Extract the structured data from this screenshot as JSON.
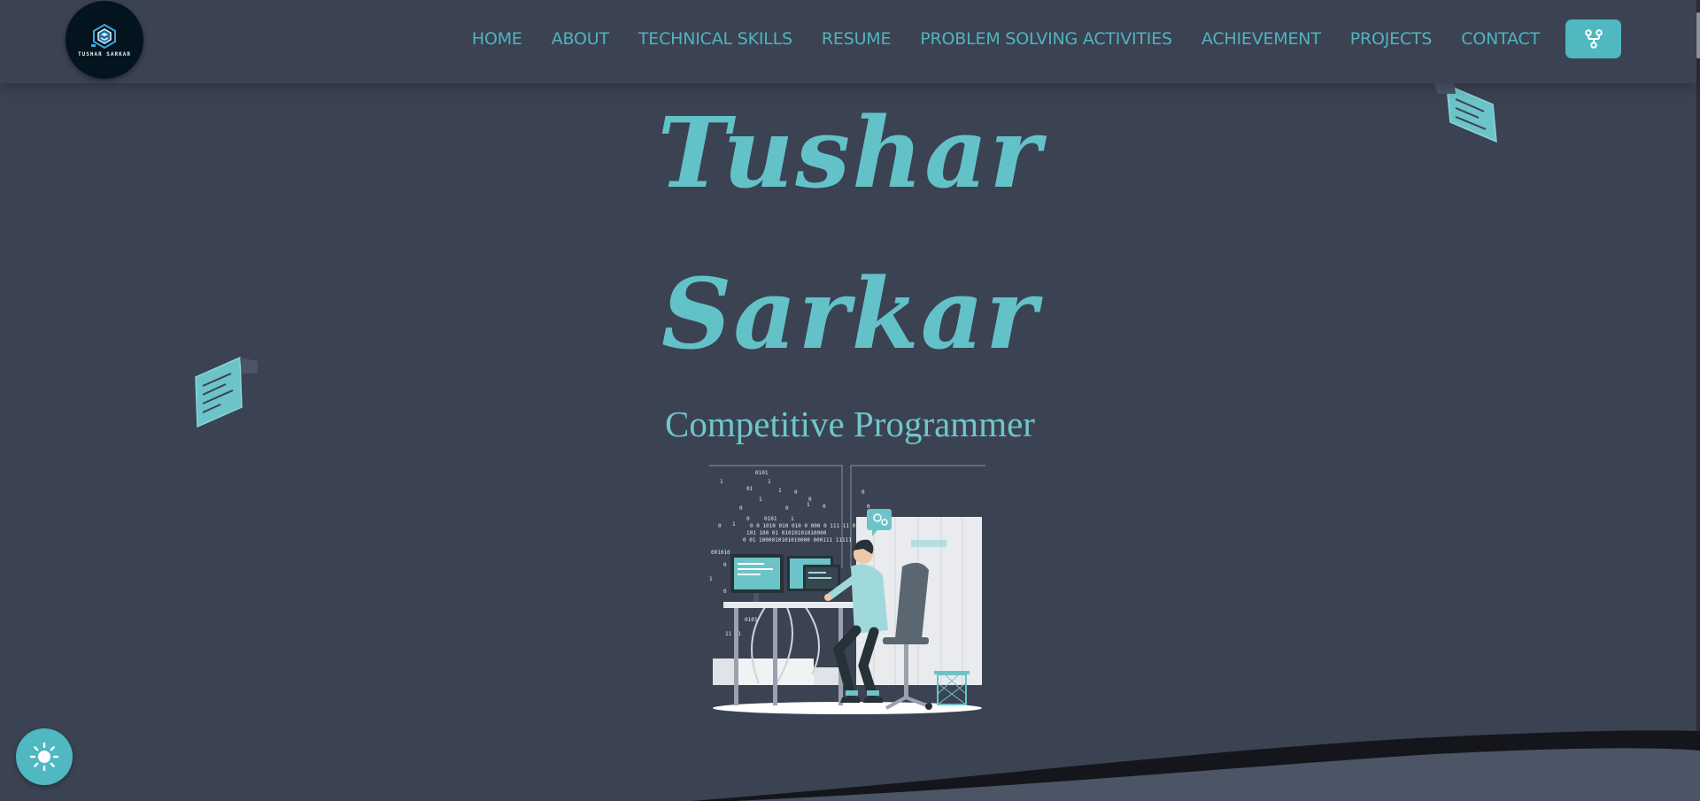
{
  "logo": {
    "text": "TUSHAR SARKAR",
    "icon": "logo-emblem-icon"
  },
  "nav": {
    "items": [
      {
        "label": "HOME",
        "name": "nav-home"
      },
      {
        "label": "ABOUT",
        "name": "nav-about"
      },
      {
        "label": "TECHNICAL SKILLS",
        "name": "nav-technical-skills"
      },
      {
        "label": "RESUME",
        "name": "nav-resume"
      },
      {
        "label": "PROBLEM SOLVING ACTIVITIES",
        "name": "nav-problem-solving"
      },
      {
        "label": "ACHIEVEMENT",
        "name": "nav-achievement"
      },
      {
        "label": "PROJECTS",
        "name": "nav-projects"
      },
      {
        "label": "CONTACT",
        "name": "nav-contact"
      }
    ],
    "fork_icon": "git-fork-icon"
  },
  "hero": {
    "first_name": "Tushar",
    "last_name": "Sarkar",
    "subtitle": "Competitive Programmer",
    "illustration": "programmer-at-desk-illustration"
  },
  "theme_toggle_icon": "sun-icon",
  "colors": {
    "background": "#3b4252",
    "accent": "#4fb8c1",
    "text_accent": "#63c2c8",
    "logo_bg": "#04141e"
  }
}
